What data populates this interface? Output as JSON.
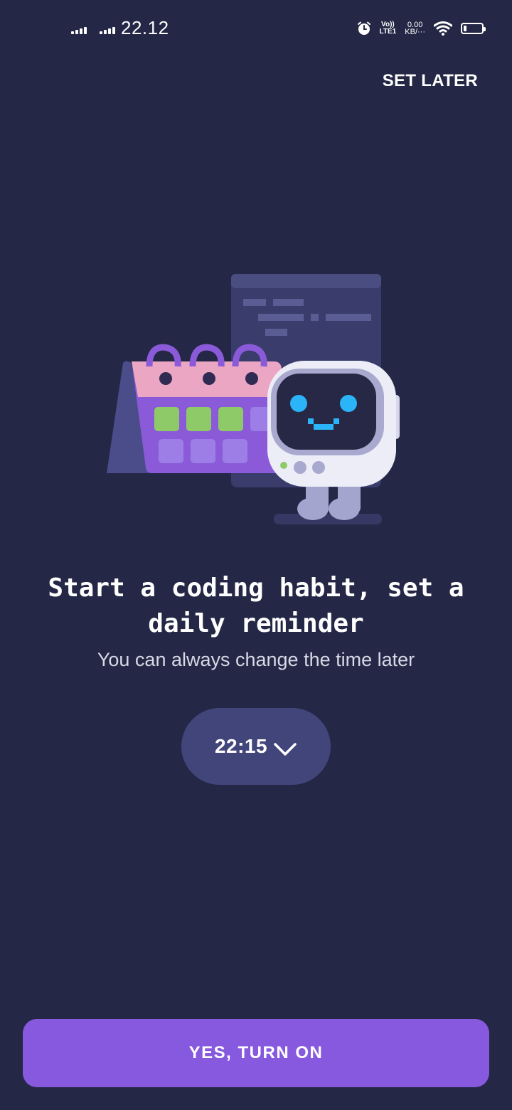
{
  "status_bar": {
    "time": "22.12",
    "volte": "Vo))\nLTE1",
    "speed": "0.00\nKB/···",
    "battery_level": 0.15,
    "icons": [
      "signal-icon",
      "signal-icon",
      "alarm-icon",
      "volte-icon",
      "wifi-icon",
      "battery-icon"
    ]
  },
  "header": {
    "set_later_label": "SET LATER"
  },
  "illustration": {
    "description_icon": "calendar-robot-illustration"
  },
  "content": {
    "title": "Start a coding habit, set a daily reminder",
    "subtitle": "You can always change the time later"
  },
  "time_picker": {
    "value": "22:15",
    "icon": "chevron-down-icon"
  },
  "cta": {
    "label": "YES, TURN ON"
  },
  "colors": {
    "background": "#242745",
    "picker_bg": "#42457a",
    "accent": "#8659df",
    "calendar_pink": "#eba6c4",
    "calendar_purple": "#8a5ad9",
    "green": "#8fca68",
    "robot_eyes": "#2bb4f7"
  }
}
